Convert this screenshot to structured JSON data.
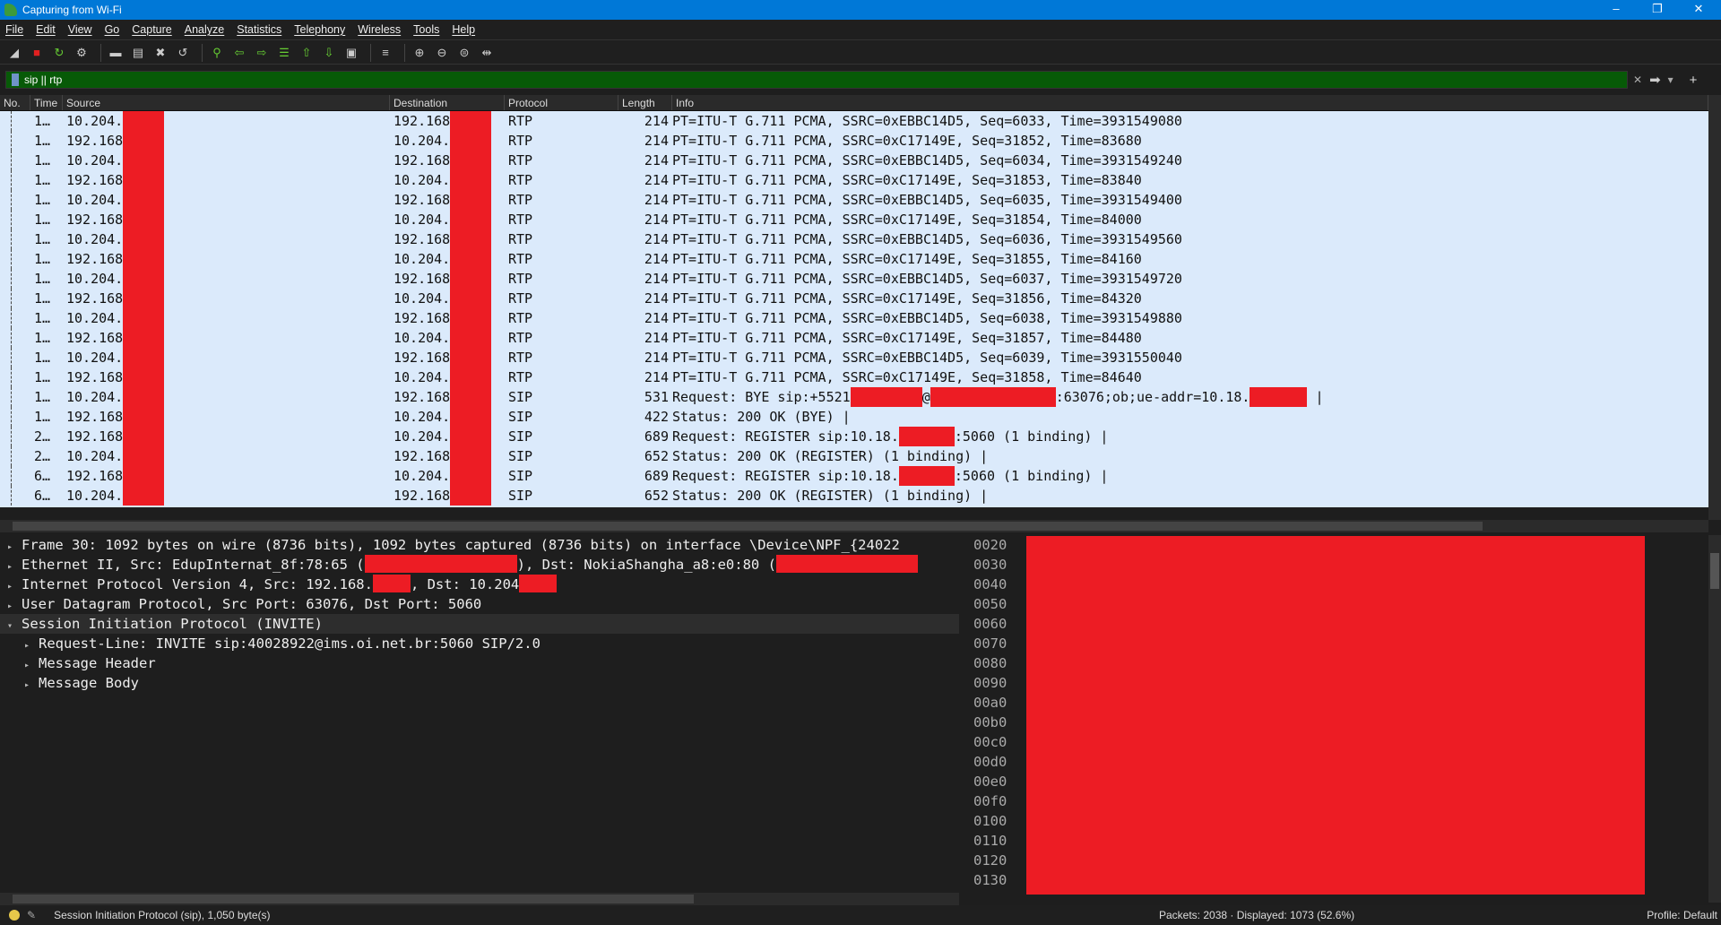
{
  "window": {
    "title": "Capturing from Wi-Fi",
    "controls": [
      "–",
      "❐",
      "✕"
    ]
  },
  "menu": [
    "File",
    "Edit",
    "View",
    "Go",
    "Capture",
    "Analyze",
    "Statistics",
    "Telephony",
    "Wireless",
    "Tools",
    "Help"
  ],
  "toolbar": [
    {
      "name": "start-capture-icon",
      "glyph": "◢"
    },
    {
      "name": "stop-capture-icon",
      "glyph": "■"
    },
    {
      "name": "restart-capture-icon",
      "glyph": "↻"
    },
    {
      "name": "capture-options-icon",
      "glyph": "⚙"
    },
    {
      "sep": true
    },
    {
      "name": "open-file-icon",
      "glyph": "▬"
    },
    {
      "name": "save-file-icon",
      "glyph": "▤"
    },
    {
      "name": "close-file-icon",
      "glyph": "✖"
    },
    {
      "name": "reload-icon",
      "glyph": "↺"
    },
    {
      "sep": true
    },
    {
      "name": "find-packet-icon",
      "glyph": "⚲"
    },
    {
      "name": "go-back-icon",
      "glyph": "⇦"
    },
    {
      "name": "go-forward-icon",
      "glyph": "⇨"
    },
    {
      "name": "go-to-packet-icon",
      "glyph": "☰"
    },
    {
      "name": "first-packet-icon",
      "glyph": "⇧"
    },
    {
      "name": "last-packet-icon",
      "glyph": "⇩"
    },
    {
      "name": "autoscroll-icon",
      "glyph": "▣"
    },
    {
      "sep": true
    },
    {
      "name": "colorize-icon",
      "glyph": "≡"
    },
    {
      "sep": true
    },
    {
      "name": "zoom-in-icon",
      "glyph": "⊕"
    },
    {
      "name": "zoom-out-icon",
      "glyph": "⊖"
    },
    {
      "name": "normal-size-icon",
      "glyph": "⊜"
    },
    {
      "name": "resize-columns-icon",
      "glyph": "⇹"
    }
  ],
  "filter": {
    "value": "sip || rtp",
    "clear_icon": "✕",
    "apply_icon": "➡",
    "dropdown_icon": "▾",
    "add_icon": "+"
  },
  "colors": {
    "filter_valid": "#075a07",
    "row_bg": "#dbeafb",
    "redaction": "#ed1c24",
    "titlebar": "#0078d7"
  },
  "columns": [
    "No.",
    "Time",
    "Source",
    "Destination",
    "Protocol",
    "Length",
    "Info"
  ],
  "packets": [
    {
      "no": "1…",
      "src": "10.204.",
      "dst": "192.168",
      "proto": "RTP",
      "len": "214",
      "info": "PT=ITU-T G.711 PCMA, SSRC=0xEBBC14D5, Seq=6033, Time=3931549080"
    },
    {
      "no": "1…",
      "src": "192.168",
      "dst": "10.204.",
      "proto": "RTP",
      "len": "214",
      "info": "PT=ITU-T G.711 PCMA, SSRC=0xC17149E, Seq=31852, Time=83680"
    },
    {
      "no": "1…",
      "src": "10.204.",
      "dst": "192.168",
      "proto": "RTP",
      "len": "214",
      "info": "PT=ITU-T G.711 PCMA, SSRC=0xEBBC14D5, Seq=6034, Time=3931549240"
    },
    {
      "no": "1…",
      "src": "192.168",
      "dst": "10.204.",
      "proto": "RTP",
      "len": "214",
      "info": "PT=ITU-T G.711 PCMA, SSRC=0xC17149E, Seq=31853, Time=83840"
    },
    {
      "no": "1…",
      "src": "10.204.",
      "dst": "192.168",
      "proto": "RTP",
      "len": "214",
      "info": "PT=ITU-T G.711 PCMA, SSRC=0xEBBC14D5, Seq=6035, Time=3931549400"
    },
    {
      "no": "1…",
      "src": "192.168",
      "dst": "10.204.",
      "proto": "RTP",
      "len": "214",
      "info": "PT=ITU-T G.711 PCMA, SSRC=0xC17149E, Seq=31854, Time=84000"
    },
    {
      "no": "1…",
      "src": "10.204.",
      "dst": "192.168",
      "proto": "RTP",
      "len": "214",
      "info": "PT=ITU-T G.711 PCMA, SSRC=0xEBBC14D5, Seq=6036, Time=3931549560"
    },
    {
      "no": "1…",
      "src": "192.168",
      "dst": "10.204.",
      "proto": "RTP",
      "len": "214",
      "info": "PT=ITU-T G.711 PCMA, SSRC=0xC17149E, Seq=31855, Time=84160"
    },
    {
      "no": "1…",
      "src": "10.204.",
      "dst": "192.168",
      "proto": "RTP",
      "len": "214",
      "info": "PT=ITU-T G.711 PCMA, SSRC=0xEBBC14D5, Seq=6037, Time=3931549720"
    },
    {
      "no": "1…",
      "src": "192.168",
      "dst": "10.204.",
      "proto": "RTP",
      "len": "214",
      "info": "PT=ITU-T G.711 PCMA, SSRC=0xC17149E, Seq=31856, Time=84320"
    },
    {
      "no": "1…",
      "src": "10.204.",
      "dst": "192.168",
      "proto": "RTP",
      "len": "214",
      "info": "PT=ITU-T G.711 PCMA, SSRC=0xEBBC14D5, Seq=6038, Time=3931549880"
    },
    {
      "no": "1…",
      "src": "192.168",
      "dst": "10.204.",
      "proto": "RTP",
      "len": "214",
      "info": "PT=ITU-T G.711 PCMA, SSRC=0xC17149E, Seq=31857, Time=84480"
    },
    {
      "no": "1…",
      "src": "10.204.",
      "dst": "192.168",
      "proto": "RTP",
      "len": "214",
      "info": "PT=ITU-T G.711 PCMA, SSRC=0xEBBC14D5, Seq=6039, Time=3931550040"
    },
    {
      "no": "1…",
      "src": "192.168",
      "dst": "10.204.",
      "proto": "RTP",
      "len": "214",
      "info": "PT=ITU-T G.711 PCMA, SSRC=0xC17149E, Seq=31858, Time=84640"
    },
    {
      "no": "1…",
      "src": "10.204.",
      "dst": "192.168",
      "proto": "SIP",
      "len": "531",
      "info": "Request: BYE sip:+5521",
      "info_parts": [
        "Request: BYE sip:+5521",
        "@",
        ":63076;ob;ue-addr=10.18."
      ]
    },
    {
      "no": "1…",
      "src": "192.168",
      "dst": "10.204.",
      "proto": "SIP",
      "len": "422",
      "info": "Status: 200 OK (BYE) |"
    },
    {
      "no": "2…",
      "src": "192.168",
      "dst": "10.204.",
      "proto": "SIP",
      "len": "689",
      "info": "Request: REGISTER sip:10.18.",
      "info_parts": [
        "Request: REGISTER sip:10.18.",
        ":5060  (1 binding) |"
      ]
    },
    {
      "no": "2…",
      "src": "10.204.",
      "dst": "192.168",
      "proto": "SIP",
      "len": "652",
      "info": "Status: 200 OK (REGISTER)  (1 binding) |"
    },
    {
      "no": "6…",
      "src": "192.168",
      "dst": "10.204.",
      "proto": "SIP",
      "len": "689",
      "info": "Request: REGISTER sip:10.18.",
      "info_parts": [
        "Request: REGISTER sip:10.18.",
        ":5060  (1 binding) |"
      ]
    },
    {
      "no": "6…",
      "src": "10.204.",
      "dst": "192.168",
      "proto": "SIP",
      "len": "652",
      "info": "Status: 200 OK (REGISTER)  (1 binding) |"
    }
  ],
  "details": [
    {
      "text": "Frame 30: 1092 bytes on wire (8736 bits), 1092 bytes captured (8736 bits) on interface \\Device\\NPF_{24022",
      "expanded": false,
      "level": 0
    },
    {
      "text": "Ethernet II, Src: EdupInternat_8f:78:65 (",
      "text2": "), Dst: NokiaShangha_a8:e0:80 (",
      "expanded": false,
      "level": 0
    },
    {
      "text": "Internet Protocol Version 4, Src: 192.168.",
      "text2": ", Dst: 10.204",
      "expanded": false,
      "level": 0
    },
    {
      "text": "User Datagram Protocol, Src Port: 63076, Dst Port: 5060",
      "expanded": false,
      "level": 0
    },
    {
      "text": "Session Initiation Protocol (INVITE)",
      "expanded": true,
      "level": 0
    },
    {
      "text": "Request-Line: INVITE sip:40028922@ims.oi.net.br:5060 SIP/2.0",
      "expanded": false,
      "level": 1
    },
    {
      "text": "Message Header",
      "expanded": false,
      "level": 1
    },
    {
      "text": "Message Body",
      "expanded": false,
      "level": 1
    }
  ],
  "hex_offsets": [
    "0020",
    "0030",
    "0040",
    "0050",
    "0060",
    "0070",
    "0080",
    "0090",
    "00a0",
    "00b0",
    "00c0",
    "00d0",
    "00e0",
    "00f0",
    "0100",
    "0110",
    "0120",
    "0130"
  ],
  "status": {
    "field": "Session Initiation Protocol (sip), 1,050 byte(s)",
    "packets": "Packets: 2038 · Displayed: 1073 (52.6%)",
    "profile": "Profile: Default"
  }
}
